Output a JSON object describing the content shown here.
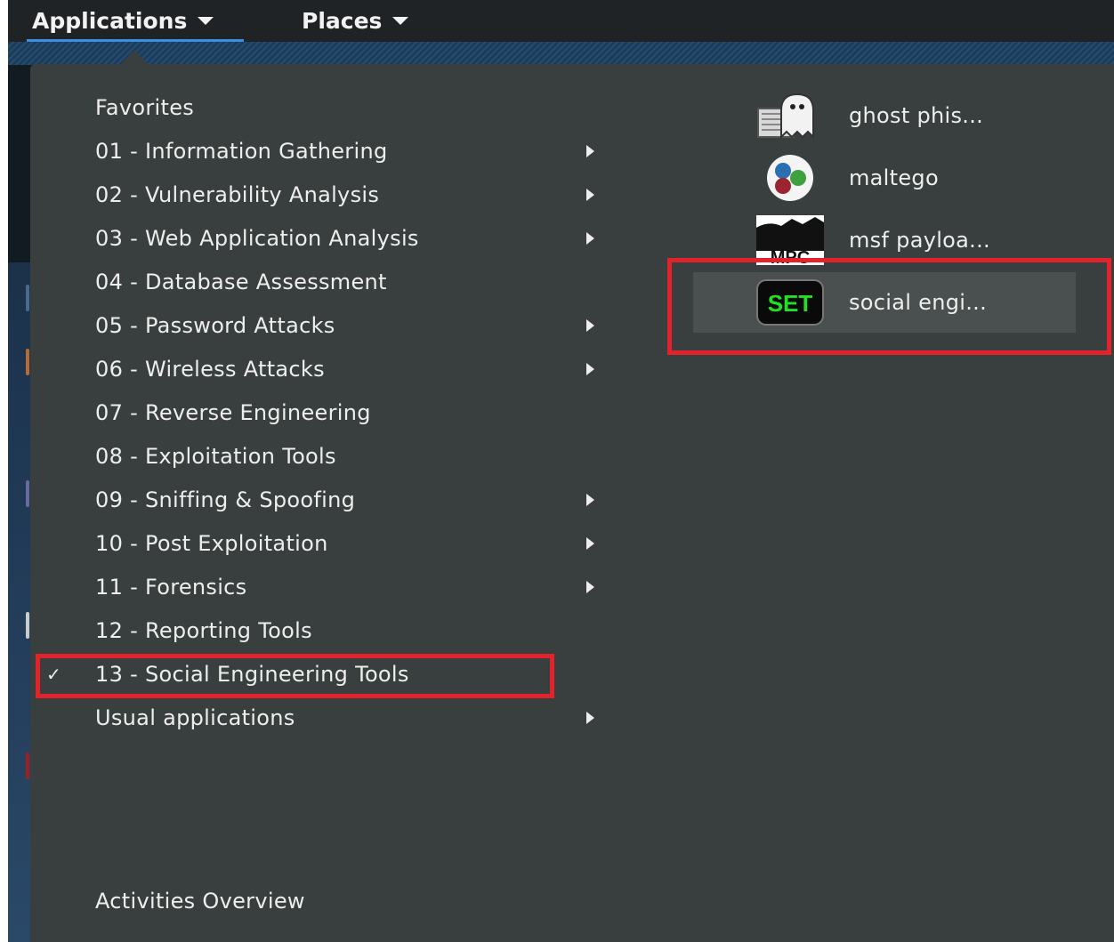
{
  "topbar": {
    "applications_label": "Applications",
    "places_label": "Places"
  },
  "categories": [
    {
      "label": "Favorites",
      "has_submenu": false,
      "checked": false
    },
    {
      "label": "01 - Information Gathering",
      "has_submenu": true,
      "checked": false
    },
    {
      "label": "02 - Vulnerability Analysis",
      "has_submenu": true,
      "checked": false
    },
    {
      "label": "03 - Web Application Analysis",
      "has_submenu": true,
      "checked": false
    },
    {
      "label": "04 - Database Assessment",
      "has_submenu": false,
      "checked": false
    },
    {
      "label": "05 - Password Attacks",
      "has_submenu": true,
      "checked": false
    },
    {
      "label": "06 - Wireless Attacks",
      "has_submenu": true,
      "checked": false
    },
    {
      "label": "07 - Reverse Engineering",
      "has_submenu": false,
      "checked": false
    },
    {
      "label": "08 - Exploitation Tools",
      "has_submenu": false,
      "checked": false
    },
    {
      "label": "09 - Sniffing & Spoofing",
      "has_submenu": true,
      "checked": false
    },
    {
      "label": "10 - Post Exploitation",
      "has_submenu": true,
      "checked": false
    },
    {
      "label": "11 - Forensics",
      "has_submenu": true,
      "checked": false
    },
    {
      "label": "12 - Reporting Tools",
      "has_submenu": false,
      "checked": false
    },
    {
      "label": "13 - Social Engineering Tools",
      "has_submenu": false,
      "checked": true
    },
    {
      "label": "Usual applications",
      "has_submenu": true,
      "checked": false
    }
  ],
  "check_glyph": "✓",
  "apps": [
    {
      "label": "ghost phis...",
      "icon": "ghost-phisher-icon"
    },
    {
      "label": "maltego",
      "icon": "maltego-icon"
    },
    {
      "label": "msf payloa...",
      "icon": "msf-payload-icon",
      "icon_text": "MPC"
    },
    {
      "label": "social engi...",
      "icon": "set-icon",
      "icon_text": "SET",
      "selected": true
    }
  ],
  "footer": {
    "activities_label": "Activities Overview"
  },
  "colors": {
    "menu_bg": "#393f3f",
    "topbar_bg": "#1f2326",
    "accent_blue": "#3d8ee0",
    "highlight_red": "#e3222b",
    "set_green": "#22e022"
  }
}
